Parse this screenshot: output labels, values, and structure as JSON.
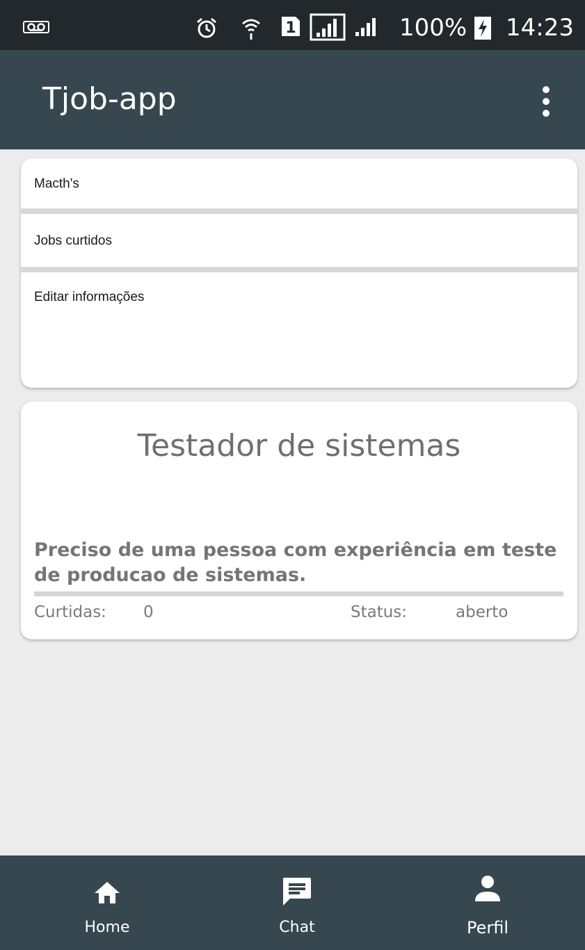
{
  "status_bar": {
    "battery": "100%",
    "time": "14:23",
    "sim_slot": "1",
    "icons": [
      "voicemail-icon",
      "alarm-icon",
      "wifi-icon",
      "sim-icon",
      "signal-icon",
      "signal-icon",
      "battery-charging-icon"
    ]
  },
  "app_bar": {
    "title": "Tjob-app",
    "menu_icon": "more-vert-icon"
  },
  "menu": {
    "items": [
      {
        "label": "Macth's"
      },
      {
        "label": "Jobs curtidos"
      },
      {
        "label": "Editar informações"
      }
    ]
  },
  "job": {
    "title": "Testador de sistemas",
    "description": "Preciso de uma pessoa com experiência em teste de producao de sistemas.",
    "likes_label": "Curtidas:",
    "likes_value": "0",
    "status_label": "Status:",
    "status_value": "aberto"
  },
  "bottom_nav": {
    "items": [
      {
        "label": "Home",
        "icon": "home-icon"
      },
      {
        "label": "Chat",
        "icon": "chat-icon"
      },
      {
        "label": "Perfil",
        "icon": "person-icon"
      }
    ]
  },
  "colors": {
    "status_bar_bg": "#22282b",
    "app_bar_bg": "#37474f",
    "page_bg": "#ececec",
    "card_bg": "#ffffff",
    "job_text": "#757575"
  }
}
